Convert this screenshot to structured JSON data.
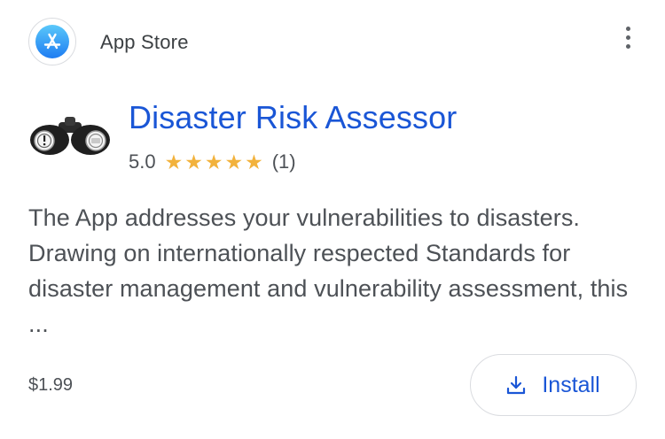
{
  "source": {
    "name": "App Store",
    "icon": "app-store-icon",
    "accent_color": "#1e7cf2"
  },
  "menu": {
    "icon": "more-vert-icon"
  },
  "app": {
    "title": "Disaster Risk Assessor",
    "icon": "binoculars-icon",
    "rating_value": "5.0",
    "rating_stars": 5,
    "rating_count": "(1)",
    "description": "The App addresses your vulnerabilities to disasters. Drawing on internationally respected Standards for disaster management and vulnerability assessment, this ..."
  },
  "footer": {
    "price": "$1.99",
    "install_label": "Install",
    "install_icon": "download-icon"
  },
  "colors": {
    "title": "#1a56d6",
    "star": "#f2b23c",
    "text": "#4d5156"
  }
}
